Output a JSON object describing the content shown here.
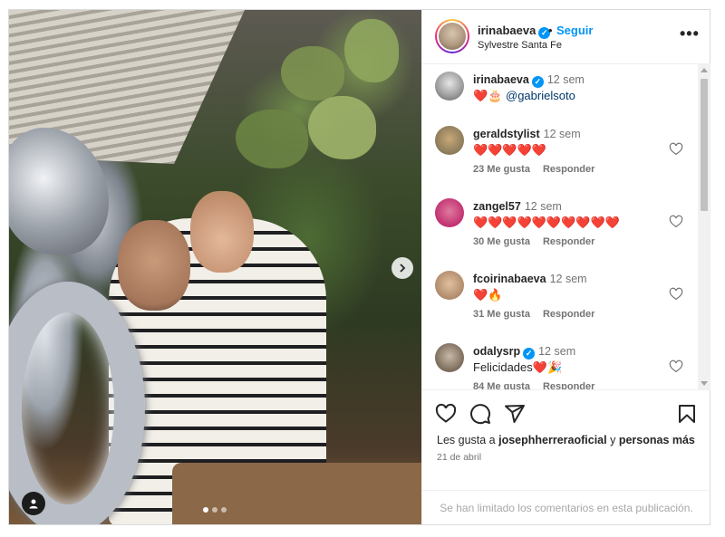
{
  "post": {
    "carousel_dots": 3,
    "active_dot": 0
  },
  "header": {
    "username": "irinabaeva",
    "separator": "•",
    "follow_label": "Seguir",
    "location": "Sylvestre Santa Fe",
    "more_label": "•••"
  },
  "caption": {
    "username": "irinabaeva",
    "time": "12 sem",
    "emoji": "❤️🎂",
    "mention": "@gabrielsoto"
  },
  "comments": [
    {
      "username": "geraldstylist",
      "verified": false,
      "time": "12 sem",
      "text": "❤️❤️❤️❤️❤️",
      "likes": "23 Me gusta",
      "reply": "Responder",
      "avatar_color": "#8a7a5a"
    },
    {
      "username": "zangel57",
      "verified": false,
      "time": "12 sem",
      "text": "❤️❤️❤️❤️❤️❤️❤️❤️❤️❤️",
      "likes": "30 Me gusta",
      "reply": "Responder",
      "avatar_color": "#c03070"
    },
    {
      "username": "fcoirinabaeva",
      "verified": false,
      "time": "12 sem",
      "text": "❤️🔥",
      "likes": "31 Me gusta",
      "reply": "Responder",
      "avatar_color": "#b08a6a"
    },
    {
      "username": "odalysrp",
      "verified": true,
      "time": "12 sem",
      "text": "Felicidades❤️🎉",
      "likes": "84 Me gusta",
      "reply": "Responder",
      "avatar_color": "#7a6a5a"
    }
  ],
  "actions": {
    "likes_prefix": "Les gusta a ",
    "likes_user": "josephherreraoficial",
    "likes_mid": " y ",
    "likes_suffix": "personas más",
    "date": "21 de abril"
  },
  "footer": {
    "limited_text": "Se han limitado los comentarios en esta publicación."
  },
  "colors": {
    "accent": "#0095f6",
    "heart": "#ed4956",
    "muted": "#737373"
  },
  "icons": [
    "verified-badge-icon",
    "more-options-icon",
    "heart-outline-icon",
    "comment-icon",
    "share-icon",
    "bookmark-icon",
    "chevron-right-icon",
    "user-tag-icon"
  ]
}
